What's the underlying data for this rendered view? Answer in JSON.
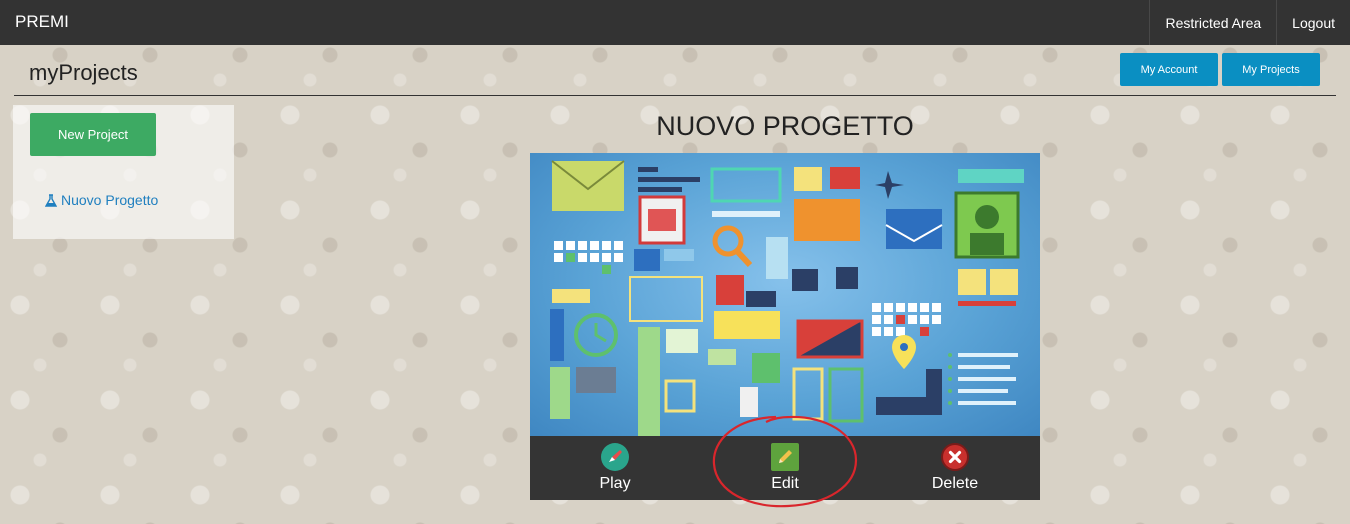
{
  "navbar": {
    "brand": "PREMI",
    "links": [
      "Restricted Area",
      "Logout"
    ]
  },
  "header": {
    "title": "myProjects",
    "buttons": [
      "My Account",
      "My Projects"
    ]
  },
  "sidebar": {
    "new_project_label": "New Project",
    "projects": [
      "Nuovo Progetto"
    ]
  },
  "project": {
    "title": "NUOVO PROGETTO",
    "actions": {
      "play": "Play",
      "edit": "Edit",
      "delete": "Delete"
    }
  },
  "colors": {
    "navbar": "#333333",
    "header_button": "#0a8fc2",
    "new_project_button": "#3daa63",
    "link": "#1f7fbf",
    "action_bar": "#343434",
    "highlight_circle": "#d9262c"
  },
  "icons": {
    "play": "rocket-icon",
    "edit": "pencil-icon",
    "delete": "close-icon",
    "project": "flask-icon"
  }
}
